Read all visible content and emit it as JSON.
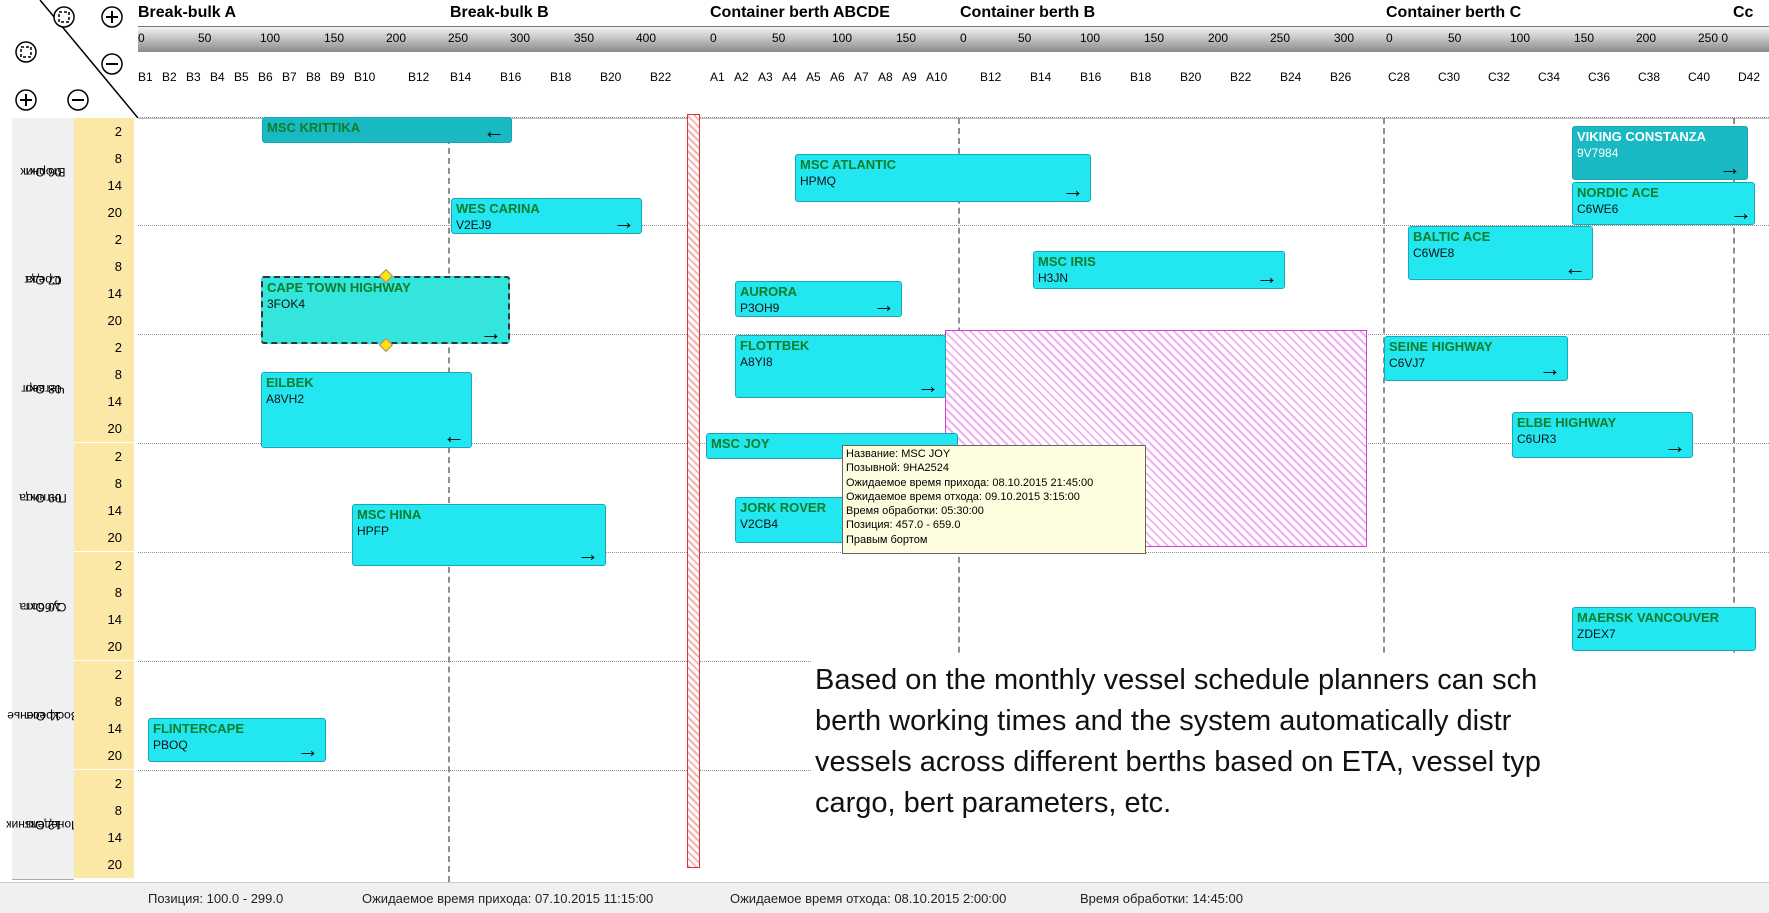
{
  "colors": {
    "vessel": "#23e7f0",
    "vessel_dark": "#18b9c2",
    "vessel_name": "#0f7d2b",
    "hours_bg": "#fbe8a6",
    "tooltip_bg": "#fffde0"
  },
  "icons": {
    "fit": "fit-icon",
    "zoom_in": "zoom-in-icon",
    "zoom_out": "zoom-out-icon"
  },
  "sections": [
    "Break-bulk A",
    "Break-bulk B",
    "Container berth ABCDE",
    "Container berth B",
    "Container berth C",
    "Cc"
  ],
  "ruler": [
    "0",
    "50",
    "100",
    "150",
    "200",
    "250",
    "300",
    "350",
    "400",
    "0",
    "50",
    "100",
    "150",
    "0",
    "50",
    "100",
    "150",
    "200",
    "250",
    "300",
    "0",
    "50",
    "100",
    "150",
    "200",
    "250 0"
  ],
  "bollards": [
    "B1",
    "B2",
    "B3",
    "B4",
    "B5",
    "B6",
    "B7",
    "B8",
    "B9",
    "B10",
    "B12",
    "B14",
    "B16",
    "B18",
    "B20",
    "B22",
    "A1",
    "A2",
    "A3",
    "A4",
    "A5",
    "A6",
    "A7",
    "A8",
    "A9",
    "A10",
    "B12",
    "B14",
    "B16",
    "B18",
    "B20",
    "B22",
    "B24",
    "B26",
    "C28",
    "C30",
    "C32",
    "C34",
    "C36",
    "C38",
    "C40",
    "D42"
  ],
  "days": [
    {
      "date": "06 Окт",
      "weekday": "Вторник"
    },
    {
      "date": "07 Окт",
      "weekday": "Среда"
    },
    {
      "date": "08 Окт",
      "weekday": "Четверг"
    },
    {
      "date": "09 Окт",
      "weekday": "Пятница"
    },
    {
      "date": "10 Окт",
      "weekday": "Суббота"
    },
    {
      "date": "11 Окт",
      "weekday": "Воскресенье"
    },
    {
      "date": "12 Окт",
      "weekday": "Понедельник"
    }
  ],
  "hours": [
    "2",
    "8",
    "14",
    "20"
  ],
  "vessels": [
    {
      "name": "MSC KRITTIKA",
      "call": "",
      "arrow": "←",
      "style": "dark"
    },
    {
      "name": "WES CARINA",
      "call": "V2EJ9",
      "arrow": "→",
      "style": ""
    },
    {
      "name": "CAPE TOWN HIGHWAY",
      "call": "3FOK4",
      "arrow": "→",
      "style": "sel"
    },
    {
      "name": "EILBEK",
      "call": "A8VH2",
      "arrow": "←",
      "style": ""
    },
    {
      "name": "MSC HINA",
      "call": "HPFP",
      "arrow": "→",
      "style": ""
    },
    {
      "name": "FLINTERCAPE",
      "call": "PBOQ",
      "arrow": "→",
      "style": ""
    },
    {
      "name": "MSC ATLANTIC",
      "call": "HPMQ",
      "arrow": "→",
      "style": ""
    },
    {
      "name": "AURORA",
      "call": "P3OH9",
      "arrow": "→",
      "style": ""
    },
    {
      "name": "FLOTTBEK",
      "call": "A8YI8",
      "arrow": "→",
      "style": ""
    },
    {
      "name": "MSC JOY",
      "call": "",
      "arrow": "←",
      "style": ""
    },
    {
      "name": "JORK ROVER",
      "call": "V2CB4",
      "arrow": "",
      "style": ""
    },
    {
      "name": "MSC IRIS",
      "call": "H3JN",
      "arrow": "→",
      "style": ""
    },
    {
      "name": "BALTIC ACE",
      "call": "C6WE8",
      "arrow": "←",
      "style": ""
    },
    {
      "name": "SEINE HIGHWAY",
      "call": "C6VJ7",
      "arrow": "→",
      "style": ""
    },
    {
      "name": "ELBE HIGHWAY",
      "call": "C6UR3",
      "arrow": "→",
      "style": ""
    },
    {
      "name": "VIKING CONSTANZA",
      "call": "9V7984",
      "arrow": "→",
      "style": "dark"
    },
    {
      "name": "NORDIC ACE",
      "call": "C6WE6",
      "arrow": "→",
      "style": ""
    },
    {
      "name": "MAERSK VANCOUVER",
      "call": "ZDEX7",
      "arrow": "",
      "style": ""
    }
  ],
  "tooltip": [
    "Название: MSC JOY",
    "Позывной: 9HA2524",
    "Ожидаемое время прихода: 08.10.2015 21:45:00",
    "Ожидаемое время отхода: 09.10.2015 3:15:00",
    "Время обработки: 05:30:00",
    "Позиция: 457.0 - 659.0",
    "Правым бортом"
  ],
  "caption": [
    "Based on the monthly vessel schedule planners can sch",
    "berth working times and the system automatically distr",
    "vessels across different berths based on ETA, vessel typ",
    "cargo, bert parameters, etc."
  ],
  "status": {
    "position": "Позиция: 100.0   -  299.0",
    "eta": "Ожидаемое время прихода: 07.10.2015 11:15:00",
    "etd": "Ожидаемое время отхода: 08.10.2015 2:00:00",
    "processing": "Время обработки: 14:45:00"
  }
}
